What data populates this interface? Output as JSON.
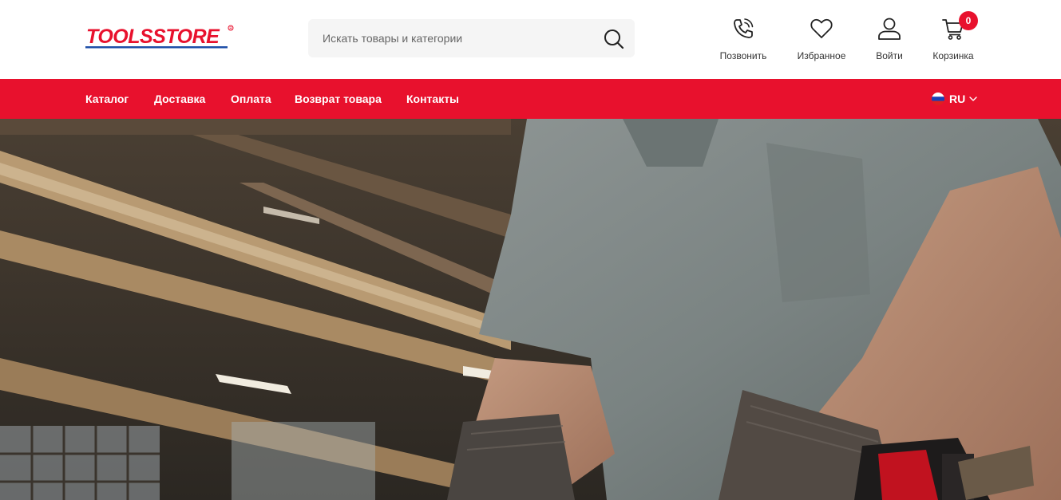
{
  "brand": {
    "name": "TOOLSSTORE",
    "color": "#1f4fa8",
    "accent": "#e8112d"
  },
  "search": {
    "placeholder": "Искать товары и категории",
    "value": ""
  },
  "header_actions": [
    {
      "label": "Позвонить",
      "icon": "phone-icon"
    },
    {
      "label": "Избранное",
      "icon": "heart-icon"
    },
    {
      "label": "Войти",
      "icon": "user-icon"
    },
    {
      "label": "Корзинка",
      "icon": "cart-icon"
    }
  ],
  "cart": {
    "count": "0"
  },
  "nav": {
    "items": [
      {
        "label": "Каталог"
      },
      {
        "label": "Доставка"
      },
      {
        "label": "Оплата"
      },
      {
        "label": "Возврат товара"
      },
      {
        "label": "Контакты"
      }
    ],
    "language": "RU"
  },
  "hero": {
    "image": "worker-with-power-tool-in-workshop-photo"
  },
  "colors": {
    "nav_bg": "#e8112d",
    "search_bg": "#f5f5f5",
    "badge_bg": "#e8112d"
  }
}
